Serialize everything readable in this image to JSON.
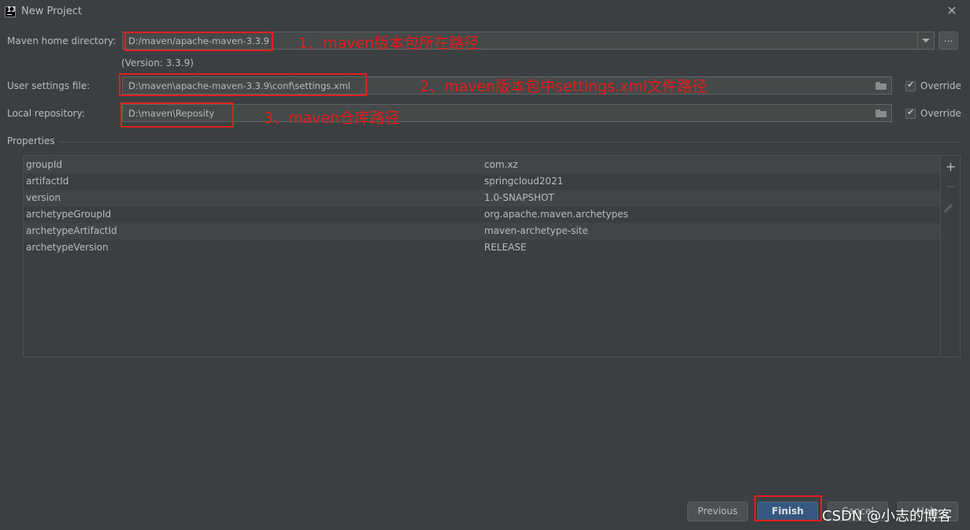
{
  "window": {
    "title": "New Project",
    "icon_letters": "IJ"
  },
  "maven_home": {
    "label": "Maven home directory:",
    "value": "D:/maven/apache-maven-3.3.9",
    "version_text": "(Version: 3.3.9)",
    "browse_label": "..."
  },
  "user_settings": {
    "label": "User settings file:",
    "value": "D:\\maven\\apache-maven-3.3.9\\conf\\settings.xml",
    "override_label": "Override",
    "override_checked": true
  },
  "local_repo": {
    "label": "Local repository:",
    "value": "D:\\maven\\Reposity",
    "override_label": "Override",
    "override_checked": true
  },
  "annotations": [
    "1、maven版本包所在路径",
    "2、maven版本包中settings.xml文件路径",
    "3、maven仓库路径"
  ],
  "properties": {
    "title": "Properties",
    "rows": [
      {
        "key": "groupId",
        "value": "com.xz"
      },
      {
        "key": "artifactId",
        "value": "springcloud2021"
      },
      {
        "key": "version",
        "value": "1.0-SNAPSHOT"
      },
      {
        "key": "archetypeGroupId",
        "value": "org.apache.maven.archetypes"
      },
      {
        "key": "archetypeArtifactId",
        "value": "maven-archetype-site"
      },
      {
        "key": "archetypeVersion",
        "value": "RELEASE"
      }
    ],
    "tools": {
      "add": "+",
      "remove": "−"
    }
  },
  "buttons": {
    "previous": "Previous",
    "finish": "Finish",
    "cancel": "Cancel",
    "help": "Help"
  },
  "watermark": "CSDN @小志的博客",
  "colors": {
    "background": "#3c3f41",
    "annotation_red": "#e51c1c",
    "primary_button": "#365880"
  }
}
